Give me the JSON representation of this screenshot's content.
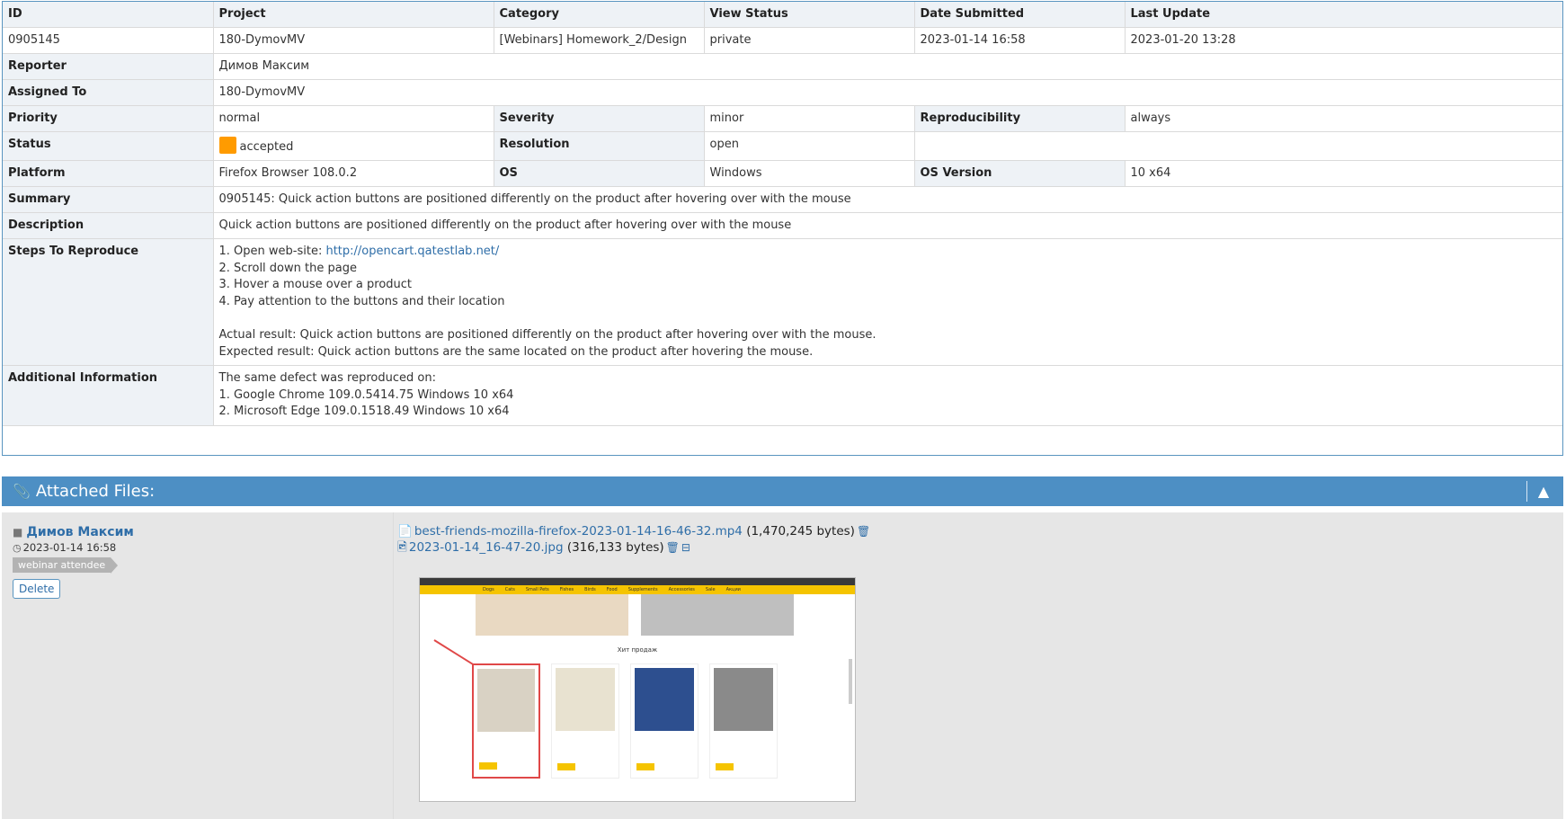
{
  "details": {
    "headers": [
      "ID",
      "Project",
      "Category",
      "View Status",
      "Date Submitted",
      "Last Update"
    ],
    "values": [
      "0905145",
      "180-DymovMV",
      "[Webinars] Homework_2/Design",
      "private",
      "2023-01-14 16:58",
      "2023-01-20 13:28"
    ],
    "reporter_label": "Reporter",
    "reporter": "Димов Максим",
    "assigned_label": "Assigned To",
    "assigned": "180-DymovMV",
    "priority_label": "Priority",
    "priority": "normal",
    "severity_label": "Severity",
    "severity": "minor",
    "reproducibility_label": "Reproducibility",
    "reproducibility": "always",
    "status_label": "Status",
    "status": "accepted",
    "status_color": "#ff9b00",
    "resolution_label": "Resolution",
    "resolution": "open",
    "platform_label": "Platform",
    "platform": "Firefox Browser 108.0.2",
    "os_label": "OS",
    "os": "Windows",
    "os_version_label": "OS Version",
    "os_version": "10 x64",
    "summary_label": "Summary",
    "summary": "0905145: Quick action buttons are positioned differently on the product after hovering over with the mouse",
    "description_label": "Description",
    "description": "Quick action buttons are positioned differently on the product after hovering over with the mouse",
    "steps_label": "Steps To Reproduce",
    "steps": {
      "step1_prefix": "1. Open web-site: ",
      "step1_link": "http://opencart.qatestlab.net/",
      "step2": "2. Scroll down the page",
      "step3": "3. Hover a mouse over a product",
      "step4": "4. Pay attention to the buttons and their location",
      "actual": "Actual result: Quick action buttons are positioned differently on the product after hovering over with the mouse.",
      "expected": "Expected result: Quick action buttons are the same located on the product after hovering the mouse."
    },
    "additional_label": "Additional Information",
    "additional": {
      "intro": "The same defect was reproduced on:",
      "line1": "1. Google Chrome 109.0.5414.75 Windows 10 x64",
      "line2": "2. Microsoft Edge 109.0.1518.49 Windows 10 x64"
    }
  },
  "attached": {
    "title": "Attached Files:",
    "author": "Димов Максим",
    "date": "2023-01-14 16:58",
    "tag": "webinar attendee",
    "delete_label": "Delete",
    "files": [
      {
        "name": "best-friends-mozilla-firefox-2023-01-14-16-46-32.mp4",
        "size": "(1,470,245 bytes)"
      },
      {
        "name": "2023-01-14_16-47-20.jpg",
        "size": "(316,133 bytes)"
      }
    ],
    "preview": {
      "nav": [
        "Dogs",
        "Cats",
        "Small Pets",
        "Fishes",
        "Birds",
        "Food",
        "Supplements",
        "Accessories",
        "Sale",
        "Акции"
      ],
      "section_title": "Хит продаж"
    }
  },
  "icons": {
    "header": "paperclip-icon",
    "collapse": "chevron-up-icon",
    "user": "user-icon",
    "clock": "clock-icon",
    "file": "file-icon",
    "image": "image-file-icon",
    "trash": "trash-icon",
    "toggle": "minus-square-icon"
  },
  "colors": {
    "header_bg": "#4d8fc4",
    "label_bg": "#eef2f6",
    "link": "#2f6ea8"
  }
}
